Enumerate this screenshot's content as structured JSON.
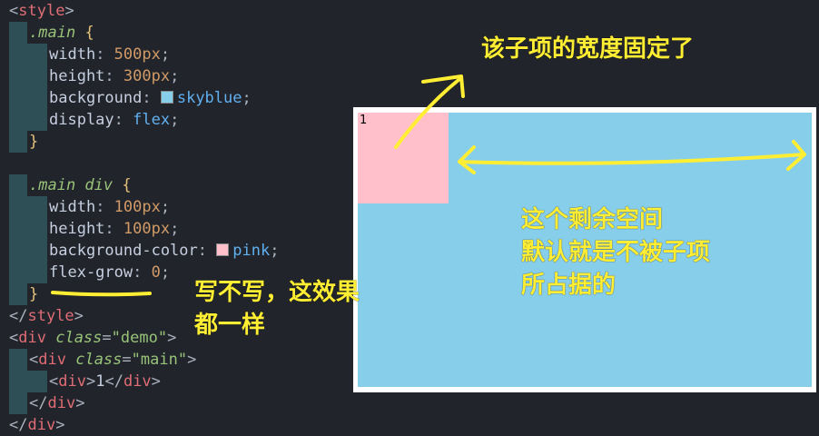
{
  "code": {
    "line1": {
      "tag": "style"
    },
    "line2": {
      "selector": ".main",
      "brace": "{"
    },
    "line3": {
      "prop": "width",
      "value": "500px"
    },
    "line4": {
      "prop": "height",
      "value": "300px"
    },
    "line5": {
      "prop": "background",
      "value": "skyblue",
      "swatch": "#87ceeb"
    },
    "line6": {
      "prop": "display",
      "value": "flex"
    },
    "line7": {
      "brace": "}"
    },
    "line9": {
      "selector": ".main div",
      "brace": "{"
    },
    "line10": {
      "prop": "width",
      "value": "100px"
    },
    "line11": {
      "prop": "height",
      "value": "100px"
    },
    "line12": {
      "prop": "background-color",
      "value": "pink",
      "swatch": "#ffc0cb"
    },
    "line13": {
      "prop": "flex-grow",
      "value": "0"
    },
    "line14": {
      "brace": "}"
    },
    "line15": {
      "tag": "style"
    },
    "line16": {
      "tag": "div",
      "attr": "class",
      "val": "\"demo\""
    },
    "line17": {
      "tag": "div",
      "attr": "class",
      "val": "\"main\""
    },
    "line18": {
      "tag": "div",
      "text": "1"
    },
    "line19": {
      "tag": "div"
    },
    "line20": {
      "tag": "div"
    }
  },
  "preview": {
    "main_bg": "#87ceeb",
    "child_bg": "#ffc0cb",
    "child_text": "1"
  },
  "annotations": {
    "fixed_width": "该子项的宽度固定了",
    "same_effect": "写不写，这效果\n都一样",
    "remaining_space": "这个剩余空间\n默认就是不被子项\n所占据的"
  },
  "colors": {
    "annotation": "#ffee33",
    "editor_bg": "#21252b"
  }
}
